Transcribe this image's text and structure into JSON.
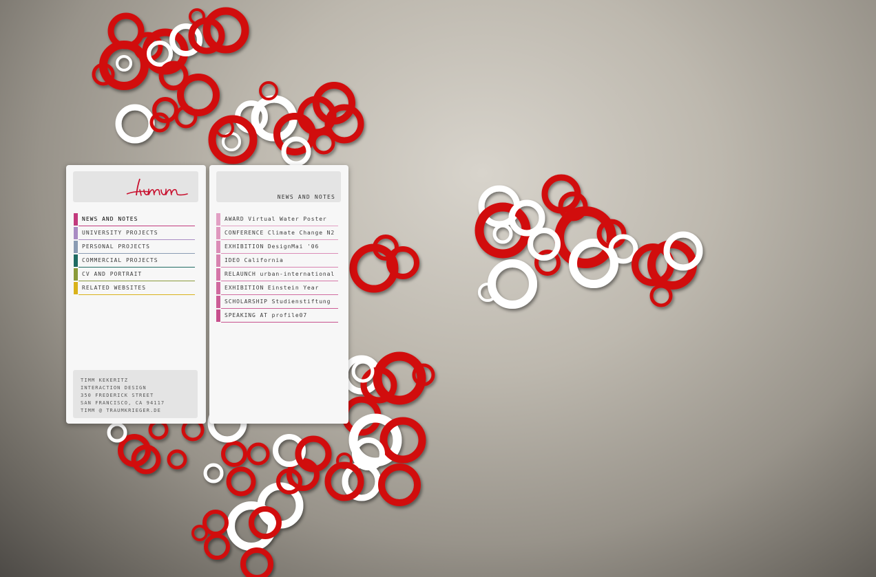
{
  "left_panel": {
    "logo_text": "timm",
    "menu": [
      {
        "label": "NEWS AND NOTES",
        "color": "#c23a7d",
        "active": true
      },
      {
        "label": "UNIVERSITY PROJECTS",
        "color": "#a98bc3",
        "active": false
      },
      {
        "label": "PERSONAL PROJECTS",
        "color": "#8a9bb3",
        "active": false
      },
      {
        "label": "COMMERCIAL PROJECTS",
        "color": "#1f6b62",
        "active": false
      },
      {
        "label": "CV AND PORTRAIT",
        "color": "#8a9a3a",
        "active": false
      },
      {
        "label": "RELATED WEBSITES",
        "color": "#d9b21a",
        "active": false
      }
    ],
    "address": [
      "TIMM KEKERITZ",
      "INTERACTION DESIGN",
      "350 FREDERICK STREET",
      "SAN FRANCISCO, CA 94117",
      "TIMM @ TRAUMKRIEGER.DE"
    ]
  },
  "right_panel": {
    "title": "NEWS AND NOTES",
    "items": [
      {
        "label": "AWARD Virtual Water Poster",
        "color": "#e2a0c4"
      },
      {
        "label": "CONFERENCE Climate Change N2",
        "color": "#df98be"
      },
      {
        "label": "EXHIBITION DesignMai '06",
        "color": "#db8db7"
      },
      {
        "label": "IDEO California",
        "color": "#d883b0"
      },
      {
        "label": "RELAUNCH urban-international",
        "color": "#d575a8"
      },
      {
        "label": "EXHIBITION Einstein Year",
        "color": "#d06a9f"
      },
      {
        "label": "SCHOLARSHIP Studienstiftung",
        "color": "#cc5d96"
      },
      {
        "label": "SPEAKING AT profile07",
        "color": "#c7508d"
      }
    ]
  },
  "colors": {
    "ring_red": "#d10a0e",
    "ring_white": "#ffffff",
    "accent": "#c23a7d"
  }
}
